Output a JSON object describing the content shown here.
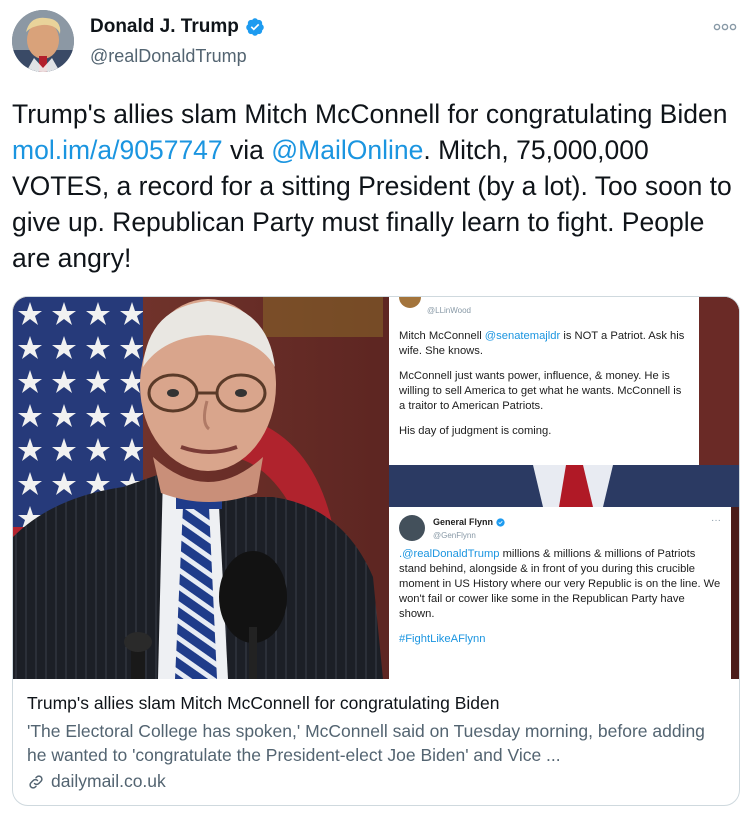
{
  "author": {
    "name": "Donald J. Trump",
    "handle": "@realDonaldTrump",
    "verified": true
  },
  "tweet": {
    "text_part1": "Trump's allies slam Mitch McConnell for congratulating Biden ",
    "link_url": "mol.im/a/9057747",
    "text_part2": " via ",
    "mention": "@MailOnline",
    "text_part3": ". Mitch, 75,000,000 VOTES, a record for a sitting President (by a lot). Too soon to give up. Republican Party must finally learn to fight. People are angry!"
  },
  "card": {
    "embed_a": {
      "handle": "@LLinWood",
      "line1_pre": "Mitch McConnell ",
      "line1_mention": "@senatemajldr",
      "line1_post": " is NOT a Patriot. Ask his wife. She knows.",
      "para2": "McConnell just wants power, influence, & money. He is willing to sell America to get what he wants. McConnell is a traitor to American Patriots.",
      "para3": "His day of judgment is coming."
    },
    "embed_b": {
      "name": "General Flynn",
      "handle": "@GenFlynn",
      "more": "···",
      "mention": ".@realDonaldTrump",
      "body": " millions & millions & millions of Patriots stand behind, alongside & in front of you during this crucible moment in US History where our very Republic is on the line. We won't fail or cower like some in the Republican Party have shown.",
      "hashtag": "#FightLikeAFlynn"
    },
    "title": "Trump's allies slam Mitch McConnell for congratulating Biden",
    "description": "'The Electoral College has spoken,' McConnell said on Tuesday morning, before adding he wanted to 'congratulate the President-elect Joe Biden' and Vice ...",
    "domain": "dailymail.co.uk"
  },
  "colors": {
    "link": "#1b95e0",
    "verified": "#1d9bf0",
    "secondary_text": "#536471",
    "border": "#cfd9de"
  },
  "icons": {
    "verified": "verified-badge-icon",
    "more": "more-options-icon",
    "link": "link-icon"
  }
}
